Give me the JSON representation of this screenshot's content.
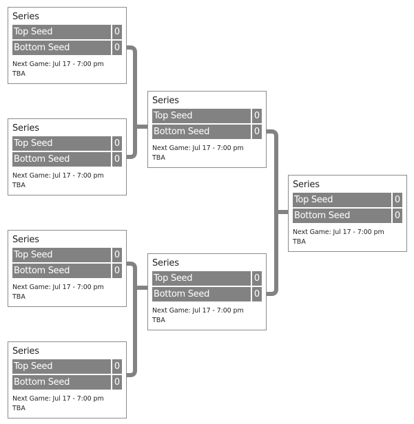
{
  "bracket": {
    "rounds": [
      {
        "name": "round-1",
        "matches": [
          {
            "title": "Series",
            "top_seed": {
              "name": "Top Seed",
              "score": "0"
            },
            "bottom_seed": {
              "name": "Bottom Seed",
              "score": "0"
            },
            "next_game": "Next Game: Jul 17 - 7:00 pm",
            "venue": "TBA"
          },
          {
            "title": "Series",
            "top_seed": {
              "name": "Top Seed",
              "score": "0"
            },
            "bottom_seed": {
              "name": "Bottom Seed",
              "score": "0"
            },
            "next_game": "Next Game: Jul 17 - 7:00 pm",
            "venue": "TBA"
          },
          {
            "title": "Series",
            "top_seed": {
              "name": "Top Seed",
              "score": "0"
            },
            "bottom_seed": {
              "name": "Bottom Seed",
              "score": "0"
            },
            "next_game": "Next Game: Jul 17 - 7:00 pm",
            "venue": "TBA"
          },
          {
            "title": "Series",
            "top_seed": {
              "name": "Top Seed",
              "score": "0"
            },
            "bottom_seed": {
              "name": "Bottom Seed",
              "score": "0"
            },
            "next_game": "Next Game: Jul 17 - 7:00 pm",
            "venue": "TBA"
          }
        ]
      },
      {
        "name": "round-2",
        "matches": [
          {
            "title": "Series",
            "top_seed": {
              "name": "Top Seed",
              "score": "0"
            },
            "bottom_seed": {
              "name": "Bottom Seed",
              "score": "0"
            },
            "next_game": "Next Game: Jul 17 - 7:00 pm",
            "venue": "TBA"
          },
          {
            "title": "Series",
            "top_seed": {
              "name": "Top Seed",
              "score": "0"
            },
            "bottom_seed": {
              "name": "Bottom Seed",
              "score": "0"
            },
            "next_game": "Next Game: Jul 17 - 7:00 pm",
            "venue": "TBA"
          }
        ]
      },
      {
        "name": "final",
        "matches": [
          {
            "title": "Series",
            "top_seed": {
              "name": "Top Seed",
              "score": "0"
            },
            "bottom_seed": {
              "name": "Bottom Seed",
              "score": "0"
            },
            "next_game": "Next Game: Jul 17 - 7:00 pm",
            "venue": "TBA"
          }
        ]
      }
    ]
  },
  "colors": {
    "seed_bg": "#828282",
    "seed_text": "#ffffff",
    "connector": "#828282",
    "border": "#8a8a8a"
  }
}
